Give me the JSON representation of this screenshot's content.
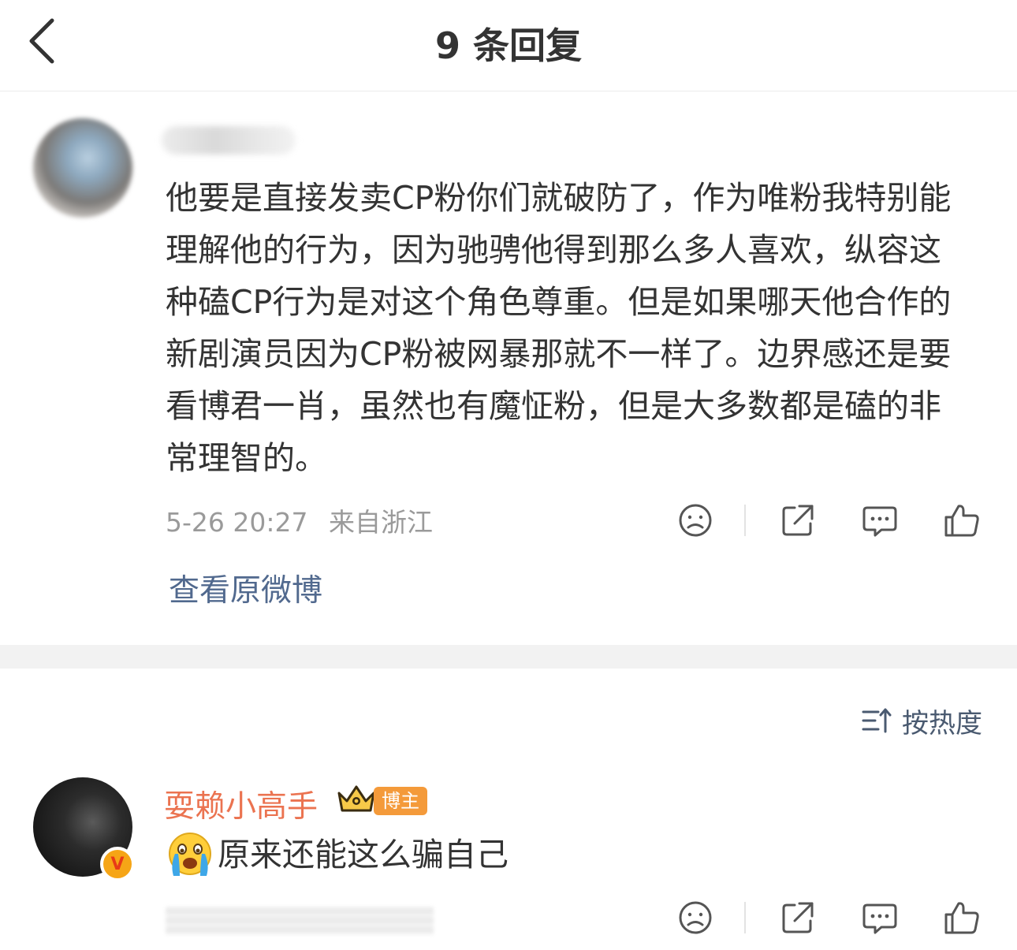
{
  "header": {
    "title": "9 条回复",
    "back_icon": "chevron-left-icon"
  },
  "post": {
    "text": "他要是直接发卖CP粉你们就破防了，作为唯粉我特别能理解他的行为，因为驰骋他得到那么多人喜欢，纵容这种磕CP行为是对这个角色尊重。但是如果哪天他合作的新剧演员因为CP粉被网暴那就不一样了。边界感还是要看博君一肖，虽然也有魔怔粉，但是大多数都是磕的非常理智的。",
    "time": "5-26 20:27",
    "location": "来自浙江",
    "view_original": "查看原微博"
  },
  "actions": {
    "icons": [
      "dislike-face-icon",
      "share-icon",
      "comment-icon",
      "like-icon"
    ]
  },
  "sort": {
    "label": "按热度",
    "icon": "sort-icon"
  },
  "reply": {
    "username": "耍赖小高手",
    "badge": "博主",
    "emoji": "crying-face-emoji",
    "text": "原来还能这么骗自己"
  },
  "colors": {
    "username": "#eb7350",
    "link": "#51698e",
    "meta": "#9a9a9a",
    "badge": "#f49a3a"
  }
}
